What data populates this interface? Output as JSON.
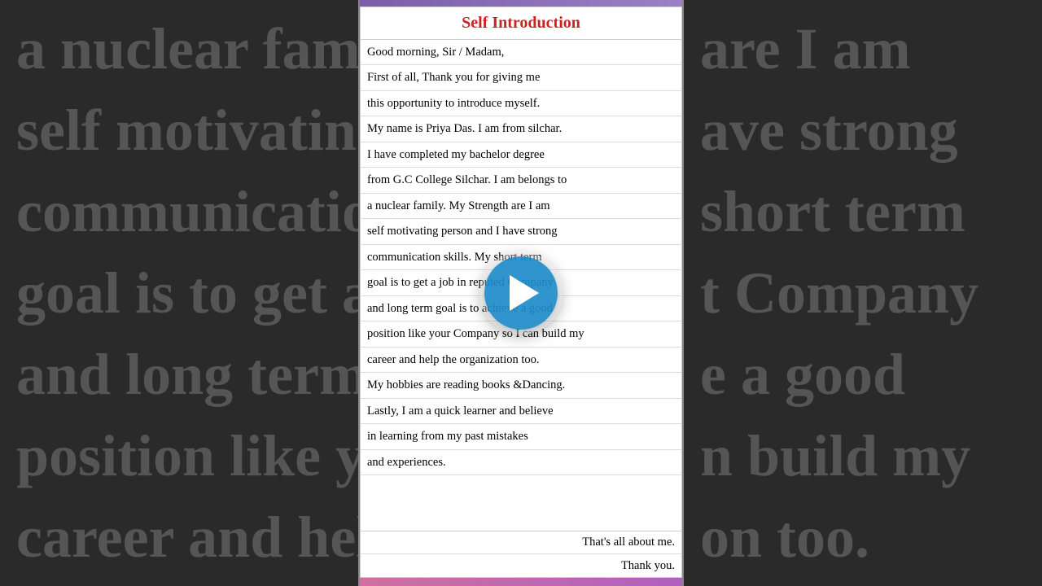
{
  "background": {
    "rows": [
      {
        "left": "a nuclear famil",
        "right": "are I am"
      },
      {
        "left": "self motivating",
        "right": "ave strong"
      },
      {
        "left": "communication",
        "right": "short term"
      },
      {
        "left": "goal is to get a",
        "right": "t Company"
      },
      {
        "left": "and long term",
        "right": "e a good"
      },
      {
        "left": "position like yo",
        "right": "n build my"
      },
      {
        "left": "career and help",
        "right": "on too."
      }
    ]
  },
  "document": {
    "title": "Self Introduction",
    "lines": [
      "Good morning,  Sir / Madam,",
      "First of all, Thank you for giving me",
      "this opportunity to introduce myself.",
      "My name is Priya Das. I am from silchar.",
      "I have completed my bachelor degree",
      "from G.C College Silchar. I am belongs to",
      "a nuclear family.  My Strength are I am",
      "self motivating person and I have strong",
      "communication skills. My short term",
      "goal is to get a job in reputed Company",
      "and long term goal is to achieve a good",
      "position like your Company so I can build my",
      "career and help the organization too.",
      "My hobbies are reading books &Dancing.",
      "Lastly, I am a quick learner and believe",
      "in learning from my past mistakes",
      "and experiences."
    ],
    "footer_lines": [
      "That's all about me.",
      "Thank you."
    ]
  },
  "play_button": {
    "aria_label": "Play video"
  }
}
